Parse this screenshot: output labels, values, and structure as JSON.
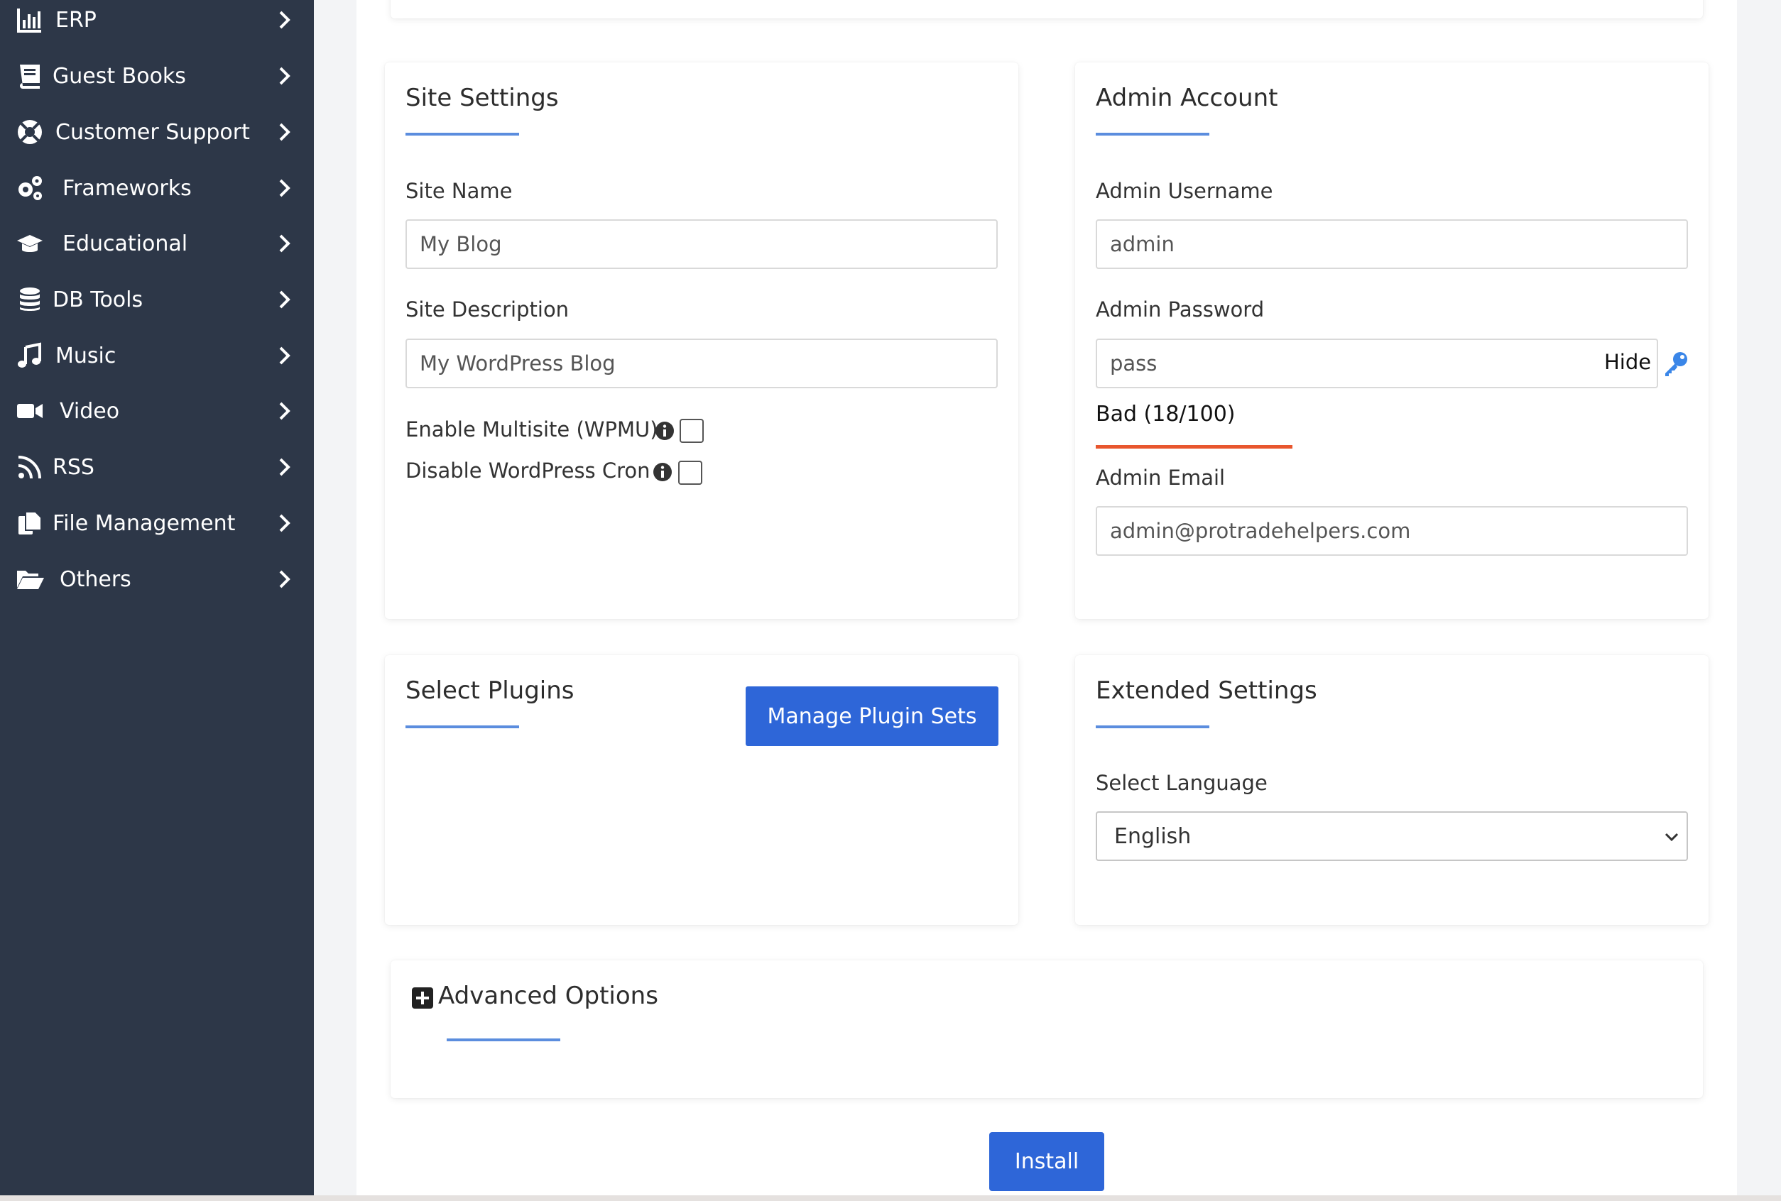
{
  "sidebar": {
    "items": [
      {
        "label": "ERP",
        "icon": "chart-bar-icon"
      },
      {
        "label": "Guest Books",
        "icon": "book-icon"
      },
      {
        "label": "Customer Support",
        "icon": "life-ring-icon"
      },
      {
        "label": "Frameworks",
        "icon": "gears-icon"
      },
      {
        "label": "Educational",
        "icon": "graduation-cap-icon"
      },
      {
        "label": "DB Tools",
        "icon": "database-icon"
      },
      {
        "label": "Music",
        "icon": "music-icon"
      },
      {
        "label": "Video",
        "icon": "video-icon"
      },
      {
        "label": "RSS",
        "icon": "rss-icon"
      },
      {
        "label": "File Management",
        "icon": "files-icon"
      },
      {
        "label": "Others",
        "icon": "folder-open-icon"
      }
    ]
  },
  "site_settings": {
    "title": "Site Settings",
    "site_name_label": "Site Name",
    "site_name_value": "My Blog",
    "site_description_label": "Site Description",
    "site_description_value": "My WordPress Blog",
    "multisite_label": "Enable Multisite (WPMU)",
    "multisite_checked": false,
    "cron_label": "Disable WordPress Cron",
    "cron_checked": false
  },
  "admin_account": {
    "title": "Admin Account",
    "username_label": "Admin Username",
    "username_value": "admin",
    "password_label": "Admin Password",
    "password_value": "pass",
    "hide_label": "Hide",
    "strength_text": "Bad (18/100)",
    "strength_score": 18,
    "strength_color": "#e8562e",
    "email_label": "Admin Email",
    "email_value": "admin@protradehelpers.com"
  },
  "plugins": {
    "title": "Select Plugins",
    "manage_button": "Manage Plugin Sets"
  },
  "extended": {
    "title": "Extended Settings",
    "language_label": "Select Language",
    "language_value": "English"
  },
  "advanced": {
    "title": "Advanced Options"
  },
  "install_button": "Install",
  "colors": {
    "sidebar_bg": "#2d3748",
    "accent_blue": "#2e66d8",
    "title_underline": "#5b8dde"
  }
}
